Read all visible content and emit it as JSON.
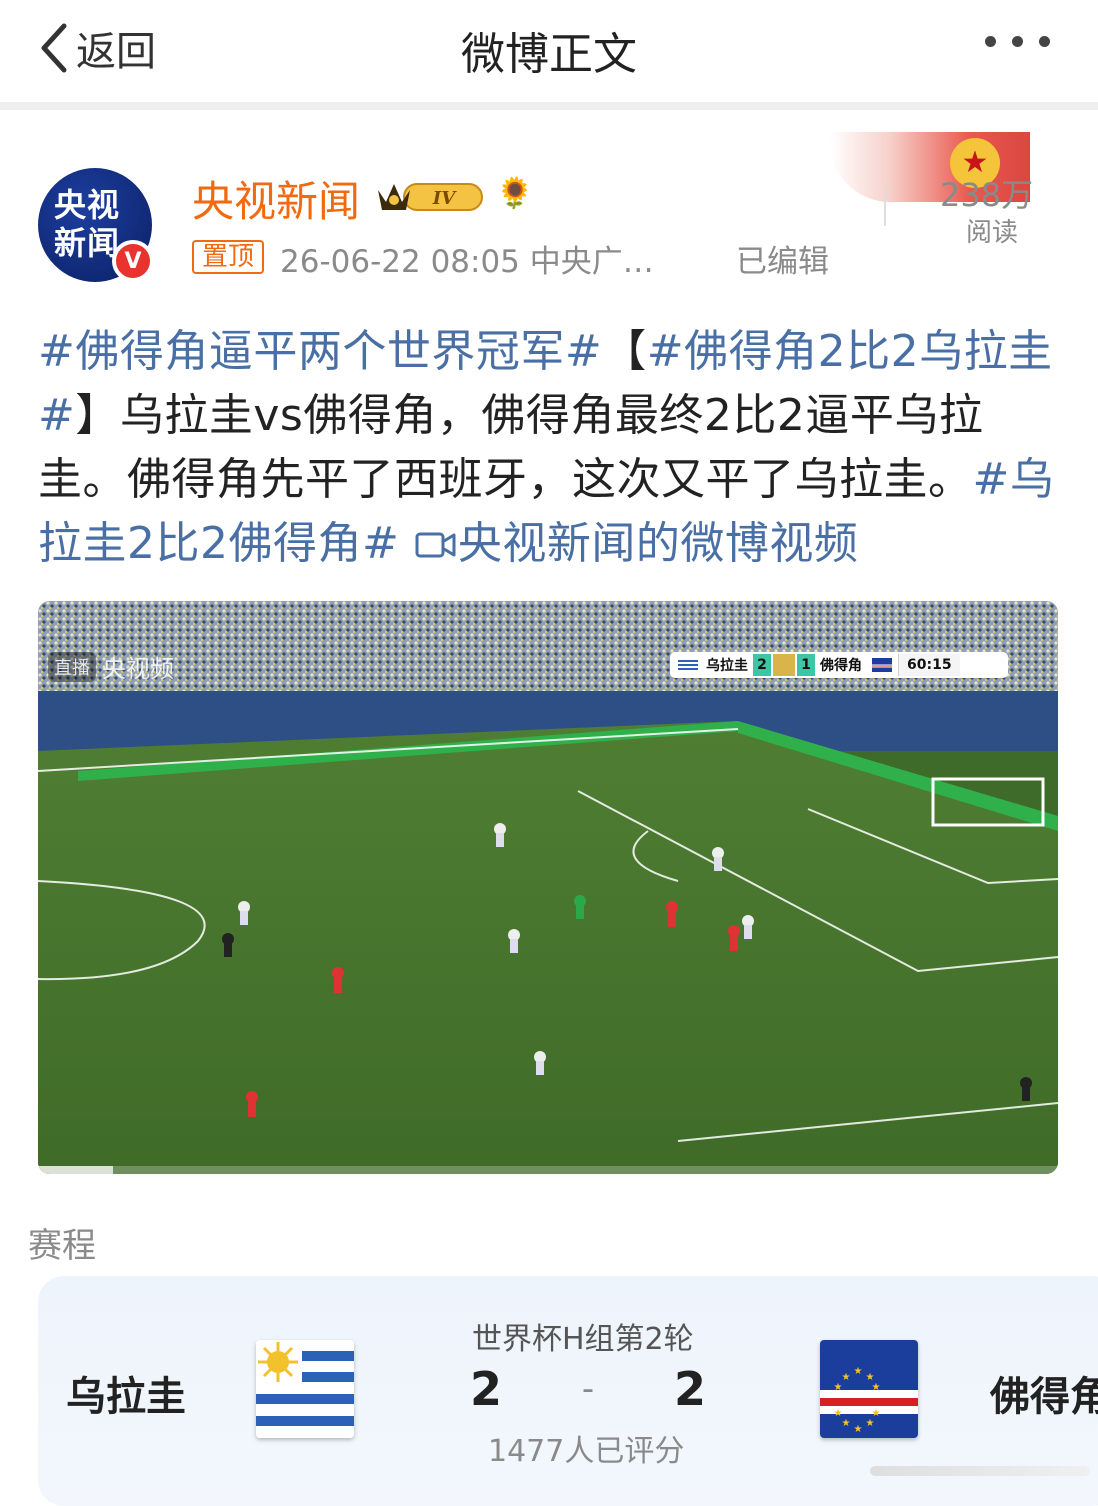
{
  "nav": {
    "back_label": "返回",
    "title": "微博正文"
  },
  "author": {
    "avatar_line1": "央视",
    "avatar_line2": "新闻",
    "name": "央视新闻",
    "vip_level": "IV",
    "pin_label": "置顶",
    "meta": "26-06-22 08:05  中央广…",
    "edited_label": "已编辑",
    "reads_count": "238万",
    "reads_label": "阅读"
  },
  "post": {
    "tag1": "#佛得角逼平两个世界冠军#",
    "bracket_open": "【",
    "tag2": "#佛得角2比2乌拉圭#",
    "bracket_close": "】",
    "body": "乌拉圭vs佛得角，佛得角最终2比2逼平乌拉圭。佛得角先平了西班牙，这次又平了乌拉圭。",
    "tag3": "#乌拉圭2比2佛得角#",
    "video_link": "央视新闻的微博视频"
  },
  "video": {
    "watermark_tag": "直播",
    "watermark_text": "央视频",
    "scoreboard": {
      "home": "乌拉圭",
      "home_score": "2",
      "away_score": "1",
      "away": "佛得角",
      "time": "60:15"
    },
    "progress": 0.074
  },
  "schedule": {
    "label": "赛程",
    "round": "世界杯H组第2轮",
    "home_team": "乌拉圭",
    "away_team": "佛得角",
    "home_score": "2",
    "dash": "-",
    "away_score": "2",
    "rating_count": "1477人已评分"
  },
  "colors": {
    "accent_orange": "#f26a10",
    "link_blue": "#4a6fa5",
    "verified_red": "#e8332e"
  }
}
